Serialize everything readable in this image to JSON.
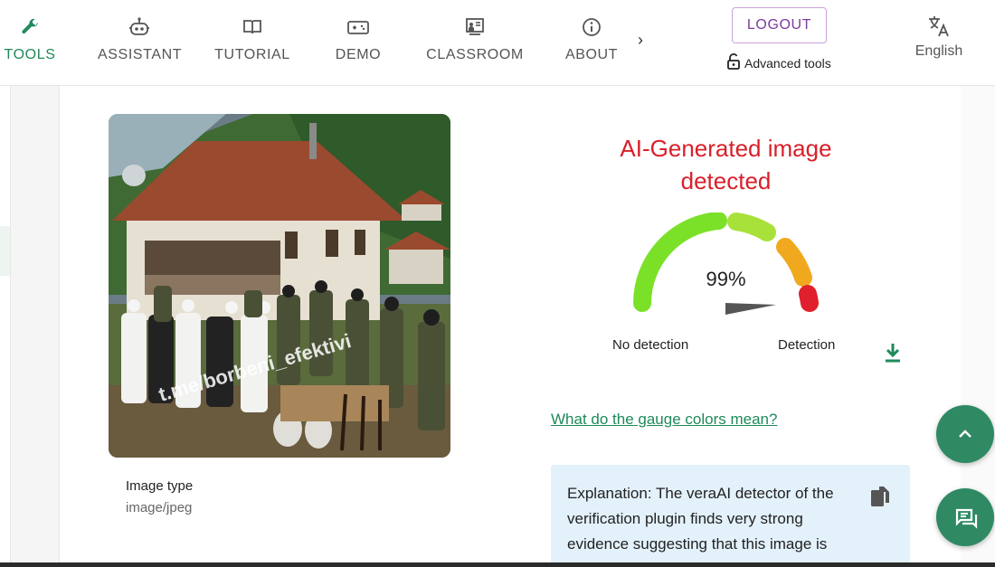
{
  "nav": {
    "items": [
      {
        "label": "TOOLS",
        "icon": "wrench-icon",
        "active": true
      },
      {
        "label": "ASSISTANT",
        "icon": "robot-icon"
      },
      {
        "label": "TUTORIAL",
        "icon": "book-icon"
      },
      {
        "label": "DEMO",
        "icon": "gamepad-icon"
      },
      {
        "label": "CLASSROOM",
        "icon": "classroom-icon"
      },
      {
        "label": "ABOUT",
        "icon": "info-icon"
      }
    ],
    "more": "›",
    "logout": "LOGOUT",
    "advanced_tools": "Advanced tools",
    "language": "English"
  },
  "image": {
    "watermark": "t.me/borbeni_efektivi",
    "type_label": "Image type",
    "type_value": "image/jpeg"
  },
  "result": {
    "title": "AI-Generated image detected",
    "percent": "99%",
    "score": 0.99,
    "no_detection": "No detection",
    "detection": "Detection",
    "gauge_link": "What do the gauge colors mean?",
    "explanation": "Explanation: The veraAI detector of the verification plugin finds very strong evidence suggesting that this image is synthetic..."
  },
  "colors": {
    "accent": "#1f8a5a",
    "alert": "#d9202a",
    "fab": "#2f8a64"
  }
}
